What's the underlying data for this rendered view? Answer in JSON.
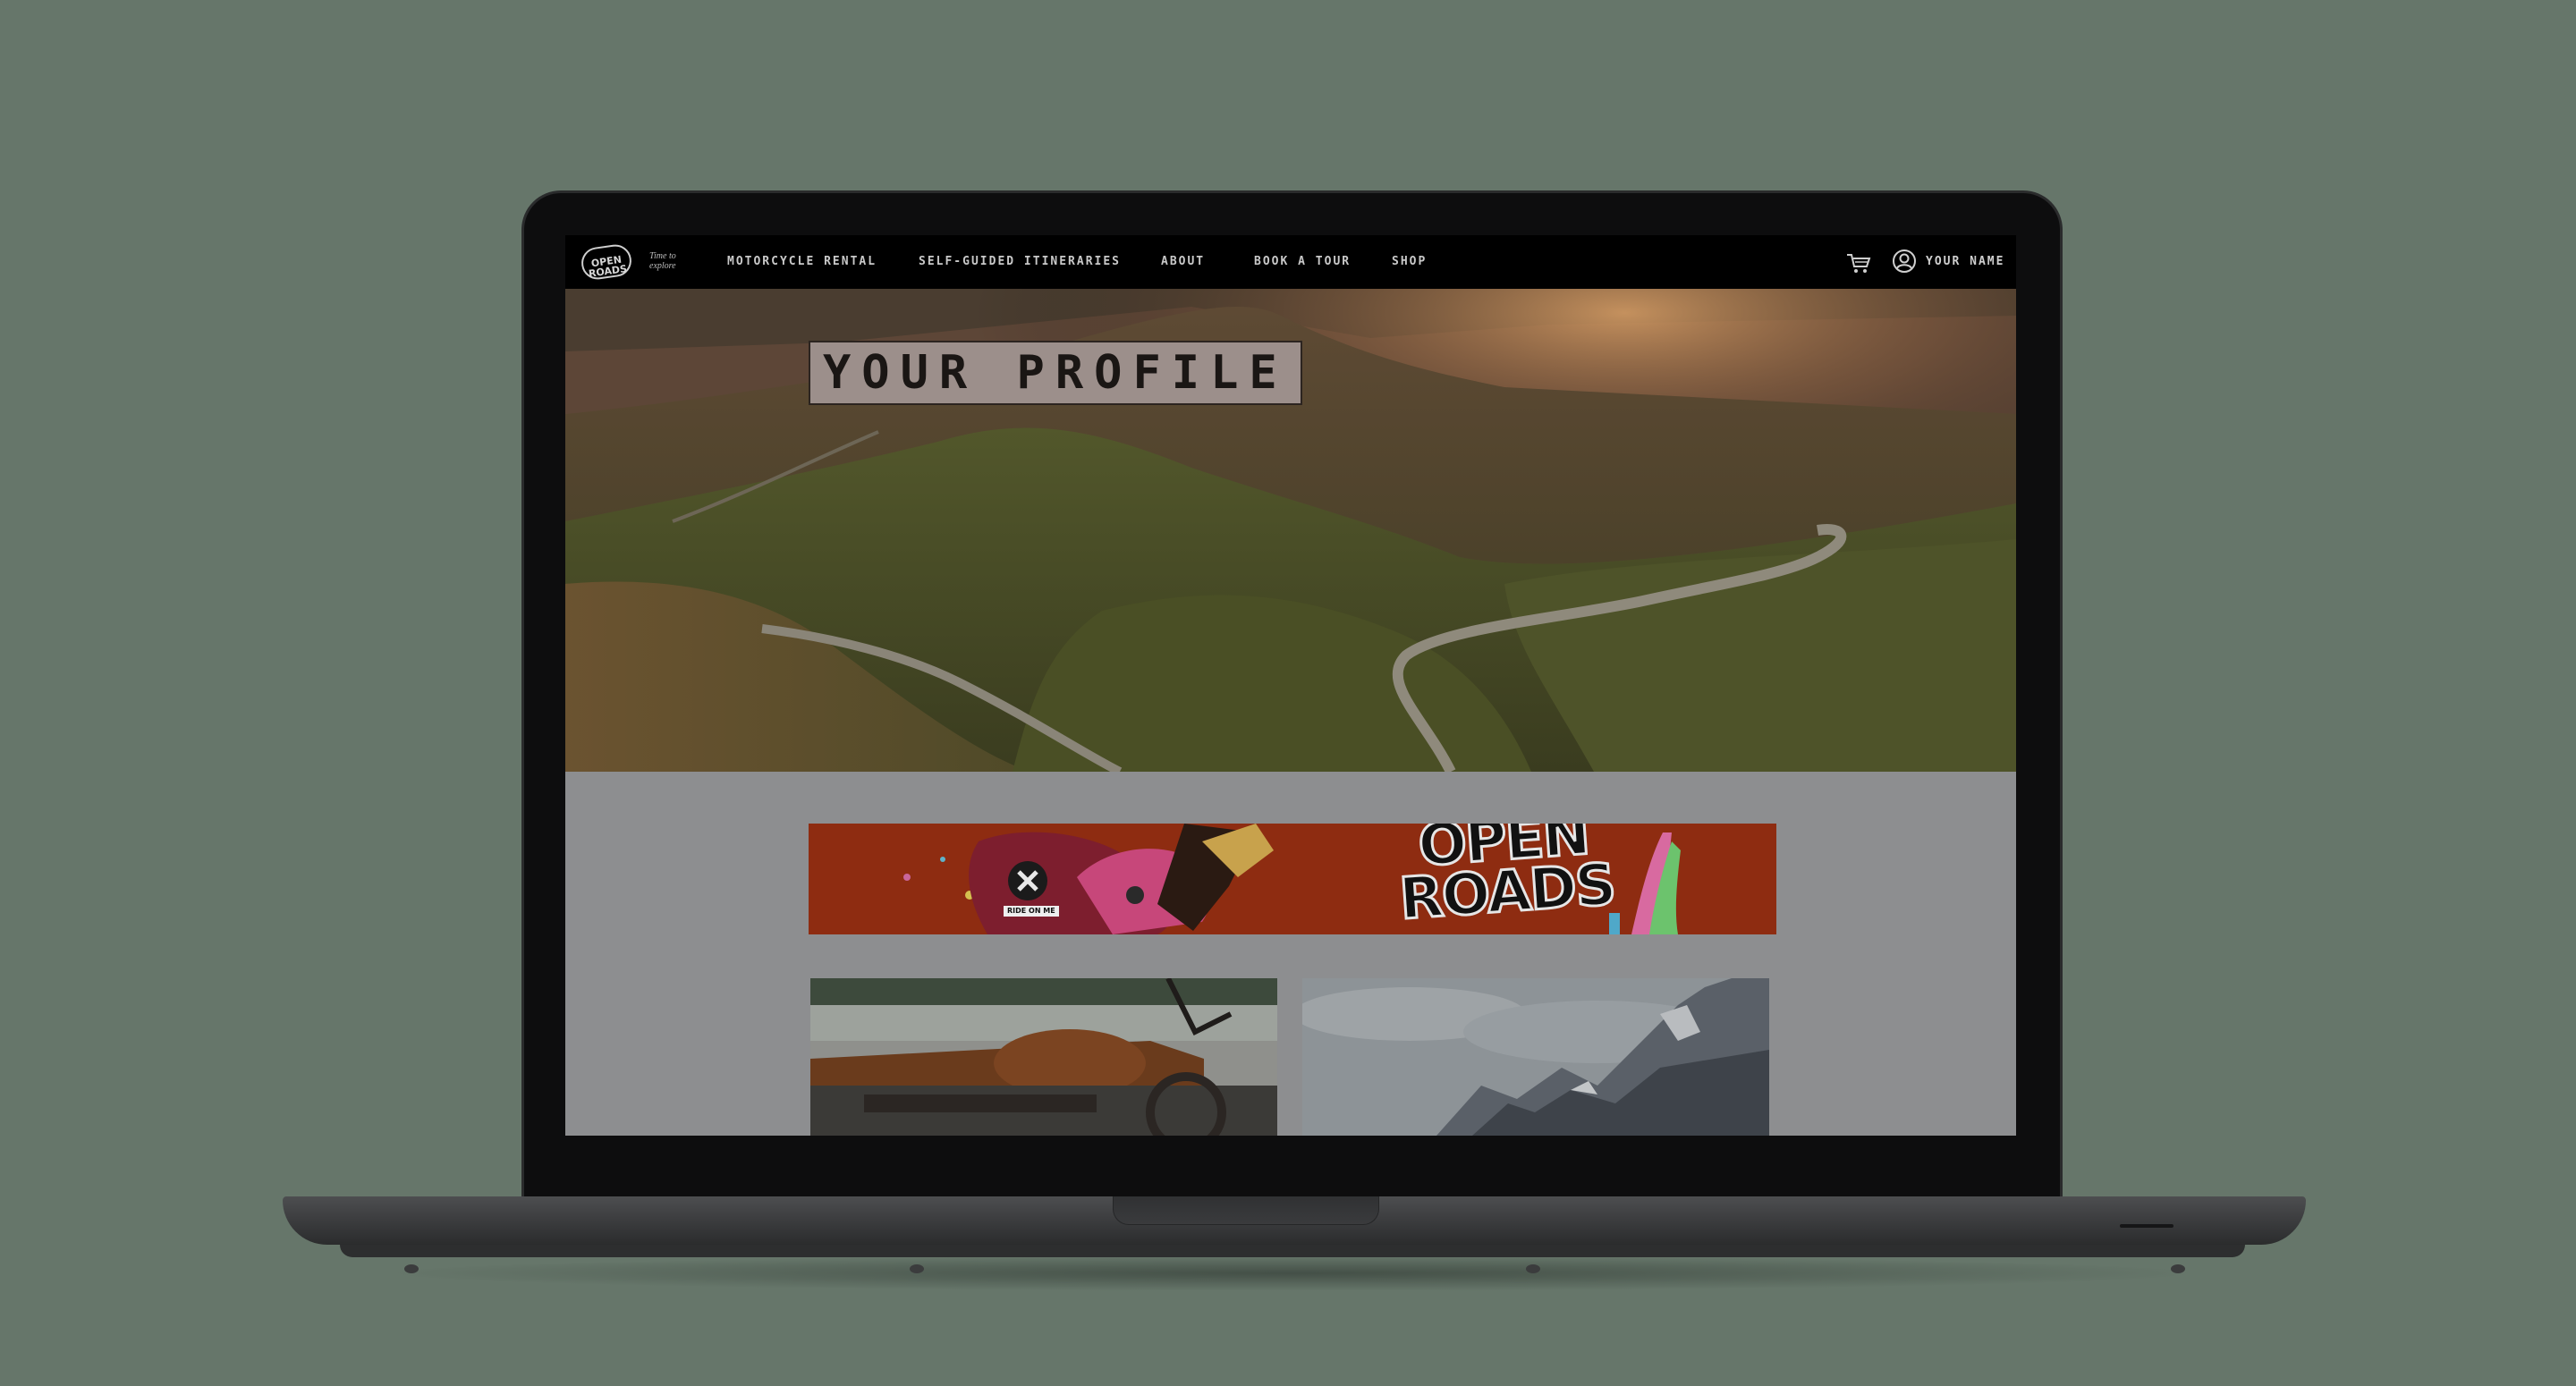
{
  "site": {
    "brand": "OPEN ROADS",
    "tagline": "Time to explore",
    "nav": [
      {
        "label": "MOTORCYCLE RENTAL"
      },
      {
        "label": "SELF-GUIDED ITINERARIES"
      },
      {
        "label": "ABOUT"
      },
      {
        "label": "BOOK A TOUR"
      },
      {
        "label": "SHOP"
      }
    ],
    "user_label": "YOUR NAME"
  },
  "hero": {
    "title": "YOUR PROFILE"
  },
  "banner": {
    "logo_text": "OPEN ROADS",
    "sticker_text": "RIDE ON ME"
  },
  "colors": {
    "background": "#66766a",
    "nav": "#000000",
    "banner": "#8e2c11",
    "screen": "#8d8e90"
  },
  "icons": [
    "cart-icon",
    "user-icon"
  ]
}
